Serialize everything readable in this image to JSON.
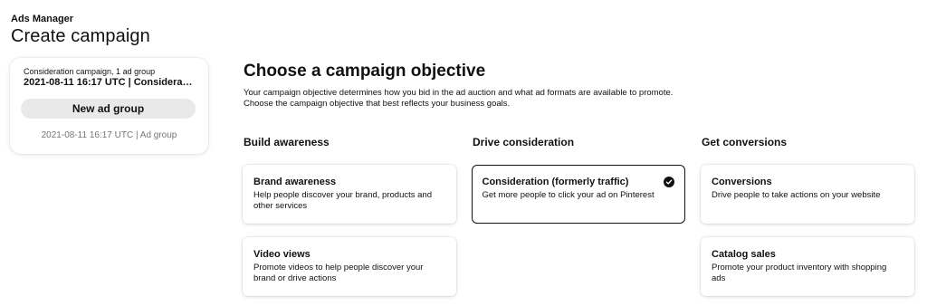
{
  "header": {
    "app_name": "Ads Manager",
    "page_title": "Create campaign"
  },
  "sidebar": {
    "campaign_subtitle": "Consideration campaign, 1 ad group",
    "campaign_name": "2021-08-11 16:17 UTC | Considerati...",
    "new_ad_group_label": "New ad group",
    "ad_group_meta": "2021-08-11 16:17 UTC | Ad group"
  },
  "main": {
    "title": "Choose a campaign objective",
    "description_line1": "Your campaign objective determines how you bid in the ad auction and what ad formats are available to promote.",
    "description_line2": "Choose the campaign objective that best reflects your business goals."
  },
  "columns": [
    {
      "heading": "Build awareness",
      "objectives": [
        {
          "title": "Brand awareness",
          "description": "Help people discover your brand, products and other services",
          "selected": false
        },
        {
          "title": "Video views",
          "description": "Promote videos to help people discover your brand or drive actions",
          "selected": false
        }
      ]
    },
    {
      "heading": "Drive consideration",
      "objectives": [
        {
          "title": "Consideration (formerly traffic)",
          "description": "Get more people to click your ad on Pinterest",
          "selected": true
        }
      ]
    },
    {
      "heading": "Get conversions",
      "objectives": [
        {
          "title": "Conversions",
          "description": "Drive people to take actions on your website",
          "selected": false
        },
        {
          "title": "Catalog sales",
          "description": "Promote your product inventory with shopping ads",
          "selected": false
        }
      ]
    }
  ],
  "icons": {
    "selected": "check-circle-icon"
  },
  "colors": {
    "text": "#111111",
    "muted": "#767676",
    "button_bg": "#e9e9e9",
    "selected_border": "#111111"
  }
}
